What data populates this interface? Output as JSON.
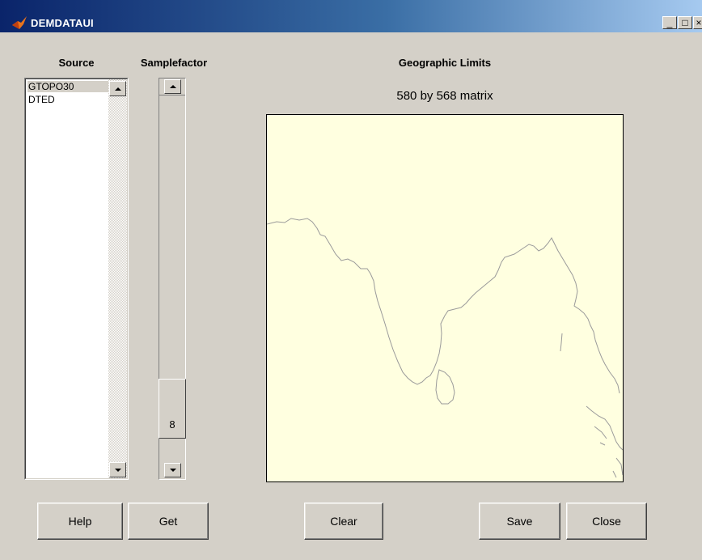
{
  "window": {
    "title": "DEMDATAUI",
    "minimize_icon": "minimize-icon",
    "maximize_icon": "maximize-icon",
    "close_icon": "close-icon"
  },
  "source": {
    "heading": "Source",
    "items": [
      "GTOPO30",
      "DTED"
    ],
    "selected": "GTOPO30"
  },
  "samplefactor": {
    "heading": "Samplefactor",
    "value": "8"
  },
  "map": {
    "heading": "Geographic Limits",
    "matrix_label": "580 by 568 matrix",
    "background_color": "#ffffe0",
    "line_color": "#a0a0a0"
  },
  "buttons": {
    "help": "Help",
    "get": "Get",
    "clear": "Clear",
    "save": "Save",
    "close": "Close"
  }
}
